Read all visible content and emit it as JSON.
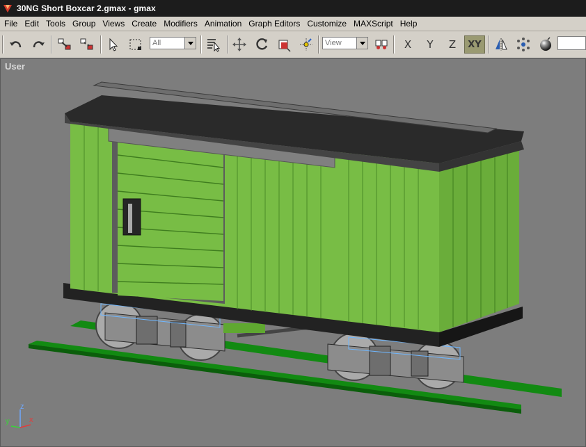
{
  "window": {
    "title": "30NG Short Boxcar 2.gmax - gmax"
  },
  "menu": [
    "File",
    "Edit",
    "Tools",
    "Group",
    "Views",
    "Create",
    "Modifiers",
    "Animation",
    "Graph Editors",
    "Customize",
    "MAXScript",
    "Help"
  ],
  "toolbar": {
    "selection_filter": "All",
    "reference_coord": "View",
    "axis_x": "X",
    "axis_y": "Y",
    "axis_z": "Z",
    "axis_xy": "XY"
  },
  "viewport": {
    "label": "User"
  },
  "axis_tripod": {
    "z": "z",
    "y": "y",
    "x": "x"
  },
  "colors": {
    "title_bg": "#1c1c1c",
    "toolbar_bg": "#d4d0c8",
    "viewport_bg": "#7d7d7d",
    "boxcar_green": "#78bd45",
    "rail_green": "#128a12"
  }
}
